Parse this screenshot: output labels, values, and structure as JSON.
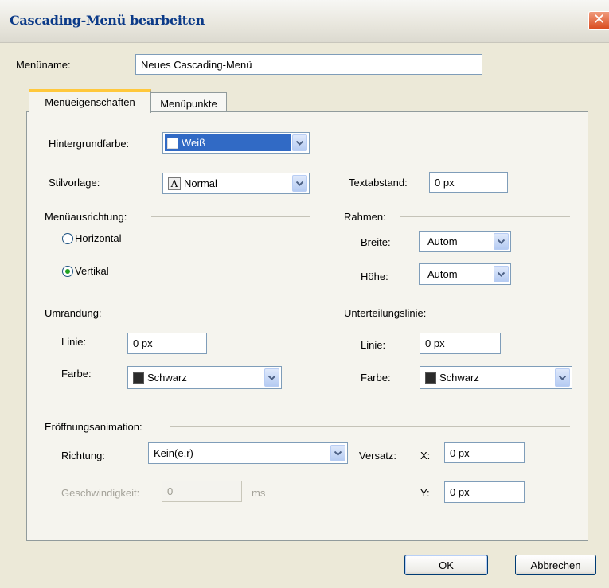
{
  "window": {
    "title": "Cascading-Menü bearbeiten",
    "close_glyph": "✕"
  },
  "menuname": {
    "label": "Menüname:",
    "value": "Neues Cascading-Menü"
  },
  "tabs": [
    {
      "label": "Menüeigenschaften",
      "active": true
    },
    {
      "label": "Menüpunkte",
      "active": false
    }
  ],
  "background": {
    "label": "Hintergrundfarbe:",
    "value": "Weiß",
    "swatch": "#ffffff"
  },
  "style": {
    "label": "Stilvorlage:",
    "value": "Normal",
    "icon": "font-A-icon"
  },
  "text_spacing": {
    "label": "Textabstand:",
    "value": "0 px"
  },
  "orientation": {
    "label": "Menüausrichtung:",
    "options": [
      "Horizontal",
      "Vertikal"
    ],
    "selected": "Vertikal"
  },
  "frame": {
    "label": "Rahmen:",
    "width_label": "Breite:",
    "width_value": "Autom",
    "height_label": "Höhe:",
    "height_value": "Autom"
  },
  "border": {
    "label": "Umrandung:",
    "line_label": "Linie:",
    "line_value": "0 px",
    "color_label": "Farbe:",
    "color_value": "Schwarz",
    "swatch": "#2b2b2b"
  },
  "divider": {
    "label": "Unterteilungslinie:",
    "line_label": "Linie:",
    "line_value": "0 px",
    "color_label": "Farbe:",
    "color_value": "Schwarz",
    "swatch": "#2b2b2b"
  },
  "animation": {
    "label": "Eröffnungsanimation:",
    "direction_label": "Richtung:",
    "direction_value": "Kein(e,r)",
    "offset_label": "Versatz:",
    "x_label": "X:",
    "x_value": "0 px",
    "y_label": "Y:",
    "y_value": "0 px",
    "speed_label": "Geschwindigkeit:",
    "speed_value": "0",
    "speed_unit": "ms"
  },
  "buttons": {
    "ok": "OK",
    "cancel": "Abbrechen"
  },
  "colors": {
    "title": "#0b3a88",
    "tab_accent": "#ffc83c",
    "selection": "#316ac5",
    "close": "#d9491d"
  }
}
